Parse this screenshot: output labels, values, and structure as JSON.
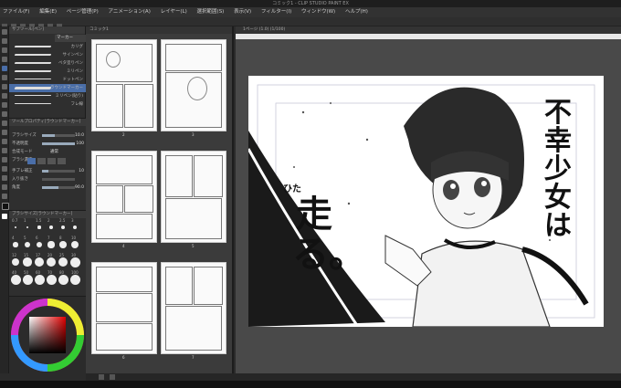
{
  "window": {
    "title": "コミック1 - CLIP STUDIO PAINT EX"
  },
  "menu": [
    "ファイル(F)",
    "編集(E)",
    "ページ管理(P)",
    "アニメーション(A)",
    "レイヤー(L)",
    "選択範囲(S)",
    "表示(V)",
    "フィルター(I)",
    "ウィンドウ(W)",
    "ヘルプ(H)"
  ],
  "subtool": {
    "header": "サブツール[ペン]",
    "tab_label": "マーカー",
    "brushes": [
      "カリグ",
      "サインペン",
      "ベタ塗りペン",
      "ミリペン",
      "ドットペン",
      "ラウンドマーカー",
      "ミリペン(貼り)",
      "フレ線"
    ]
  },
  "toolprop": {
    "header": "ツールプロパティ[ラウンドマーカー]",
    "rows": [
      {
        "label": "ブラシサイズ",
        "value": "10.0"
      },
      {
        "label": "不透明度",
        "value": "100"
      },
      {
        "label": "合成モード",
        "value": "通常"
      },
      {
        "label": "ブラシ濃度",
        "value": ""
      },
      {
        "label": "手ブレ補正",
        "value": "10"
      },
      {
        "label": "入り抜き",
        "value": ""
      },
      {
        "label": "角度",
        "value": "90.0"
      }
    ]
  },
  "brushsize": {
    "header": "ブラシサイズ[ラウンドマーカー]",
    "sizes": [
      "0.7",
      "1",
      "1.5",
      "2",
      "2.5",
      "3",
      "4",
      "5",
      "6",
      "7",
      "8",
      "10",
      "12",
      "15",
      "17",
      "20",
      "25",
      "30",
      "40",
      "50",
      "60",
      "70",
      "80",
      "100"
    ]
  },
  "pagepanel": {
    "header": "コミック1",
    "pages": [
      "2",
      "3",
      "4",
      "5",
      "6",
      "7",
      "8",
      "9"
    ]
  },
  "canvas": {
    "tab_label": "1ページ (1.0) (1/100)",
    "title_main": "不幸少女は",
    "ruby": "ひた",
    "title_sub": "走る。"
  },
  "colors": {
    "accent": "#4a6ea8",
    "panel": "#2f2f2f",
    "canvas_bg": "#494949"
  }
}
